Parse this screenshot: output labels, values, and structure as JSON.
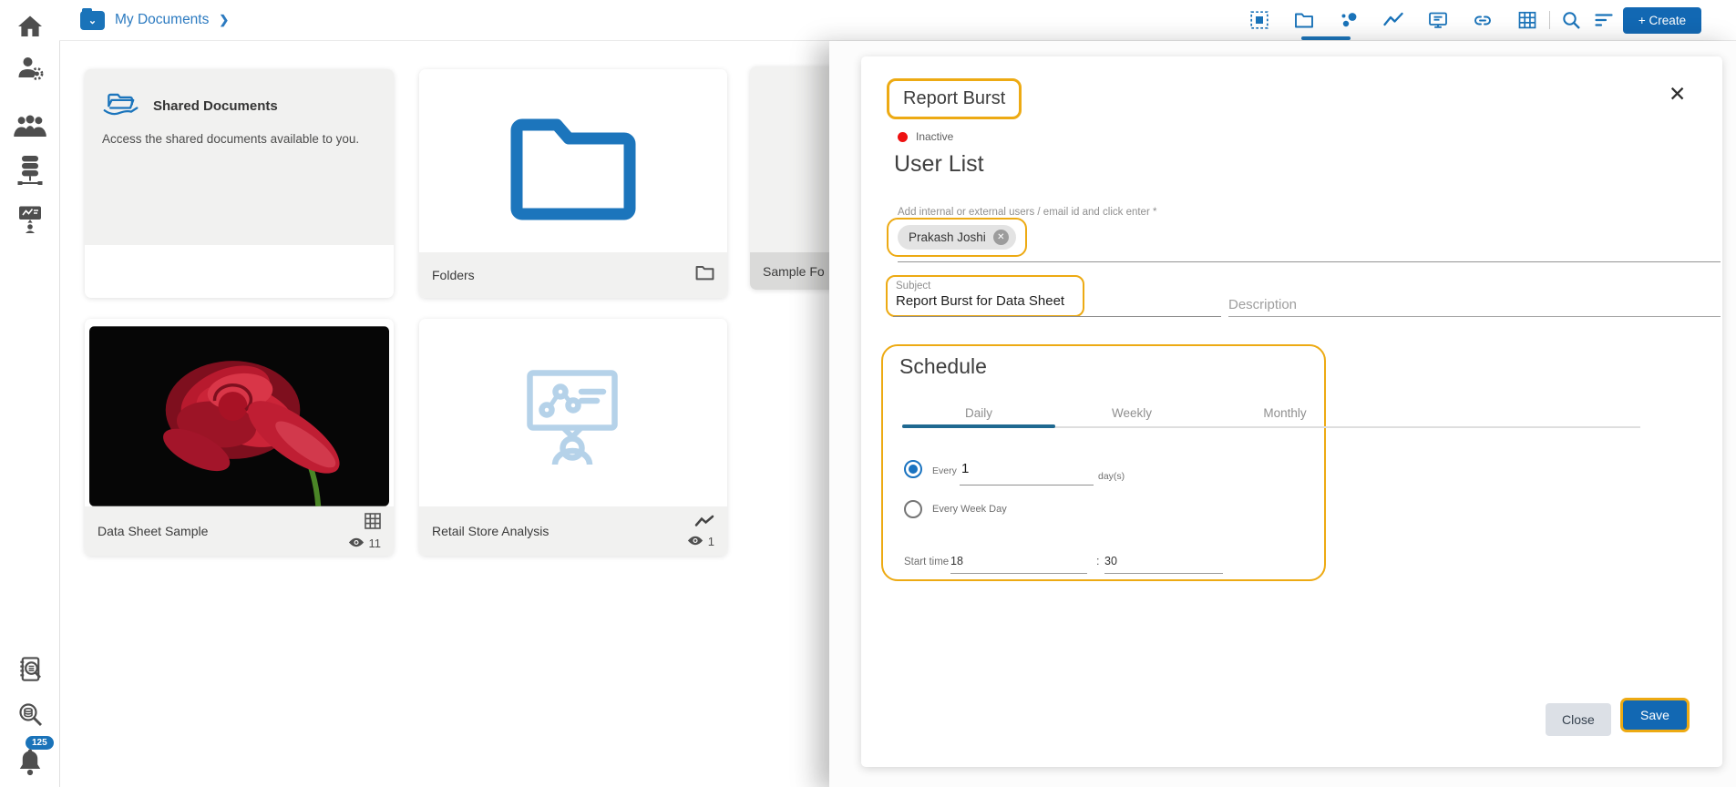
{
  "breadcrumb": {
    "label": "My Documents",
    "chevron": "❯"
  },
  "toolbar": {
    "create_label": "+ Create"
  },
  "sidebar": {
    "notification_count": "125"
  },
  "cards": {
    "shared": {
      "title": "Shared Documents",
      "description": "Access the shared documents available to you."
    },
    "folders": {
      "title": "Folders"
    },
    "sample": {
      "title": "Sample Fo"
    },
    "datasheet": {
      "title": "Data Sheet Sample",
      "views": "11"
    },
    "retail": {
      "title": "Retail Store Analysis",
      "views": "1"
    }
  },
  "panel": {
    "title": "Report Burst",
    "status": "Inactive",
    "report_name": "User List",
    "users_label": "Add internal or external users / email id and click enter *",
    "user_chip": "Prakash Joshi",
    "subject_label": "Subject",
    "subject_value": "Report Burst for Data Sheet",
    "description_placeholder": "Description",
    "schedule": {
      "title": "Schedule",
      "tabs": [
        "Daily",
        "Weekly",
        "Monthly"
      ],
      "every_label": "Every",
      "every_value": "1",
      "days_suffix": "day(s)",
      "weekday_label": "Every Week Day",
      "start_time_label": "Start time",
      "hour": "18",
      "colon": ":",
      "minute": "30"
    },
    "close_label": "Close",
    "save_label": "Save"
  },
  "icons": {
    "close_glyph": "✕",
    "chip_remove_glyph": "✕"
  },
  "colors": {
    "accent_orange": "#edaa13",
    "brand_blue": "#1a73b9",
    "button_blue": "#1268b3",
    "tab_active_blue": "#1f6991",
    "status_red": "#ee1111"
  }
}
